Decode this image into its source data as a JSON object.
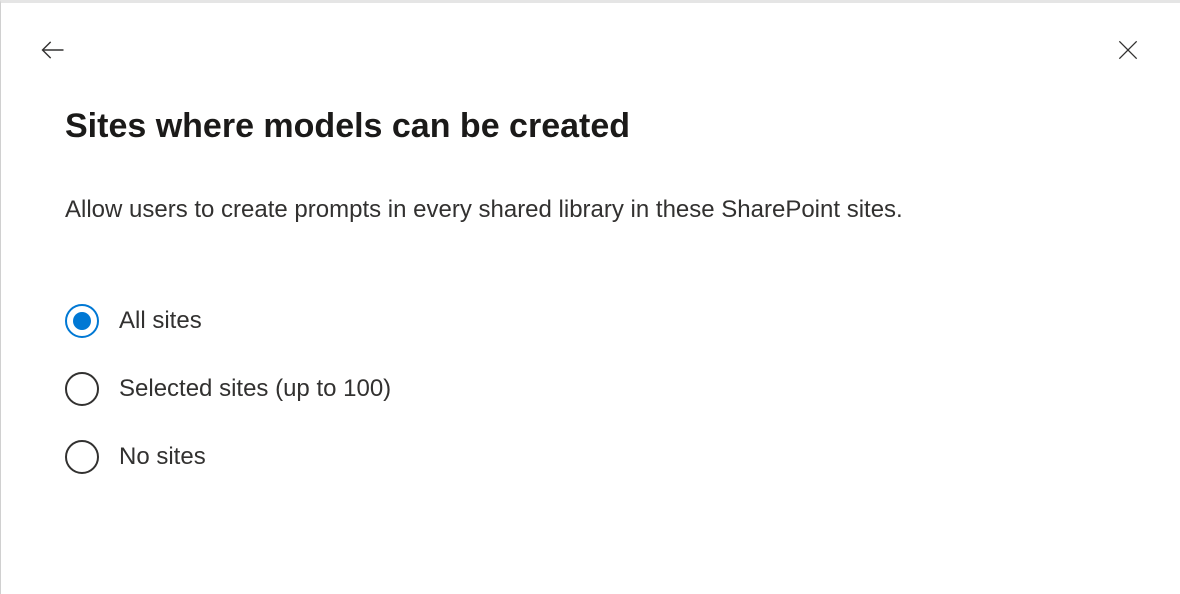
{
  "header": {
    "title": "Sites where models can be created",
    "description": "Allow users to create prompts in every shared library in these SharePoint sites."
  },
  "options": [
    {
      "id": "all-sites",
      "label": "All sites",
      "selected": true
    },
    {
      "id": "selected-sites",
      "label": "Selected sites (up to 100)",
      "selected": false
    },
    {
      "id": "no-sites",
      "label": "No sites",
      "selected": false
    }
  ]
}
